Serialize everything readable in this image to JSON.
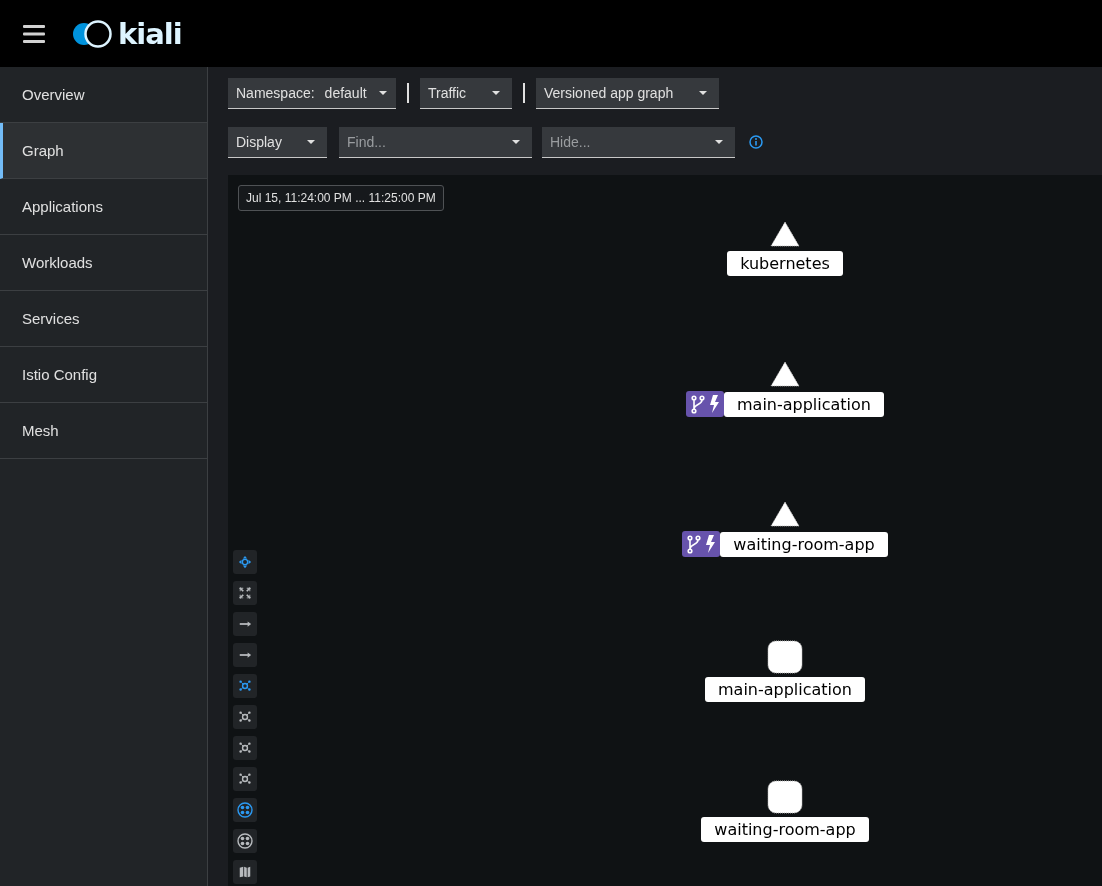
{
  "header": {
    "brand": "kiali"
  },
  "sidebar": {
    "items": [
      {
        "label": "Overview",
        "selected": false
      },
      {
        "label": "Graph",
        "selected": true
      },
      {
        "label": "Applications",
        "selected": false
      },
      {
        "label": "Workloads",
        "selected": false
      },
      {
        "label": "Services",
        "selected": false
      },
      {
        "label": "Istio Config",
        "selected": false
      },
      {
        "label": "Mesh",
        "selected": false
      }
    ]
  },
  "toolbar": {
    "row_1": [
      {
        "label": "Namespace:",
        "value": "default"
      },
      {
        "value": "Traffic"
      },
      {
        "value": "Versioned app graph"
      }
    ],
    "row_2": [
      {
        "value": "Display"
      },
      {
        "placeholder": "Find..."
      },
      {
        "placeholder": "Hide..."
      }
    ]
  },
  "graph": {
    "time_range": "Jul 15, 11:24:00 PM ... 11:25:00 PM",
    "nodes": [
      {
        "kind": "triangle",
        "label": "kubernetes",
        "badges": false
      },
      {
        "kind": "triangle",
        "label": "main-application",
        "badges": true
      },
      {
        "kind": "triangle",
        "label": "waiting-room-app",
        "badges": true
      },
      {
        "kind": "square",
        "label": "main-application",
        "badges": false
      },
      {
        "kind": "square",
        "label": "waiting-room-app",
        "badges": false
      }
    ],
    "controls": [
      {
        "kind": "pan",
        "active": true
      },
      {
        "kind": "fit",
        "active": false
      },
      {
        "kind": "arrow",
        "active": false
      },
      {
        "kind": "arrow",
        "active": false
      },
      {
        "kind": "layout",
        "active": true
      },
      {
        "kind": "layout",
        "active": false
      },
      {
        "kind": "layout",
        "active": false
      },
      {
        "kind": "layout",
        "active": false
      },
      {
        "kind": "namespace",
        "active": true
      },
      {
        "kind": "namespace",
        "active": false
      },
      {
        "kind": "map",
        "active": false
      }
    ]
  }
}
